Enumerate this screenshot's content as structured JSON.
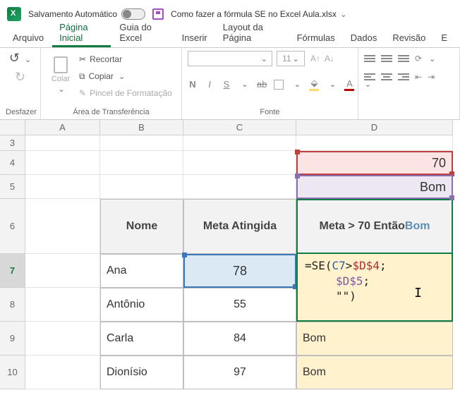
{
  "titlebar": {
    "autosave_label": "Salvamento Automático",
    "filename": "Como fazer a fórmula SE no Excel Aula.xlsx"
  },
  "menu": {
    "arquivo": "Arquivo",
    "pagina_inicial": "Página Inicial",
    "guia_excel": "Guia do Excel",
    "inserir": "Inserir",
    "layout": "Layout da Página",
    "formulas": "Fórmulas",
    "dados": "Dados",
    "revisao": "Revisão",
    "exibir": "E"
  },
  "ribbon": {
    "desfazer": {
      "label": "Desfazer"
    },
    "clipboard": {
      "colar": "Colar",
      "recortar": "Recortar",
      "copiar": "Copiar",
      "pincel": "Pincel de Formatação",
      "group": "Área de Transferência"
    },
    "font": {
      "size": "11",
      "labels": {
        "n": "N",
        "i": "I",
        "s": "S"
      },
      "group": "Fonte"
    }
  },
  "columns": {
    "a": "A",
    "b": "B",
    "c": "C",
    "d": "D"
  },
  "rows": {
    "r3": "3",
    "r4": "4",
    "r5": "5",
    "r6": "6",
    "r7": "7",
    "r8": "8",
    "r9": "9",
    "r10": "10"
  },
  "cells": {
    "d4": "70",
    "d5": "Bom",
    "hdr_nome": "Nome",
    "hdr_meta": "Meta Atingida",
    "hdr_cond_prefix": "Meta > 70 Então ",
    "hdr_cond_bom": "Bom",
    "b7": "Ana",
    "c7": "78",
    "b8": "Antônio",
    "c8": "55",
    "b9": "Carla",
    "c9": "84",
    "d9": "Bom",
    "b10": "Dionísio",
    "c10": "97",
    "d10": "Bom"
  },
  "formula": {
    "line1_pre": "=SE(",
    "line1_c7": "C7",
    "line1_gt": ">",
    "line1_d4": "$D$4",
    "line1_end": ";",
    "line2_d5": "$D$5",
    "line2_end": ";",
    "line3": "\"\")"
  }
}
